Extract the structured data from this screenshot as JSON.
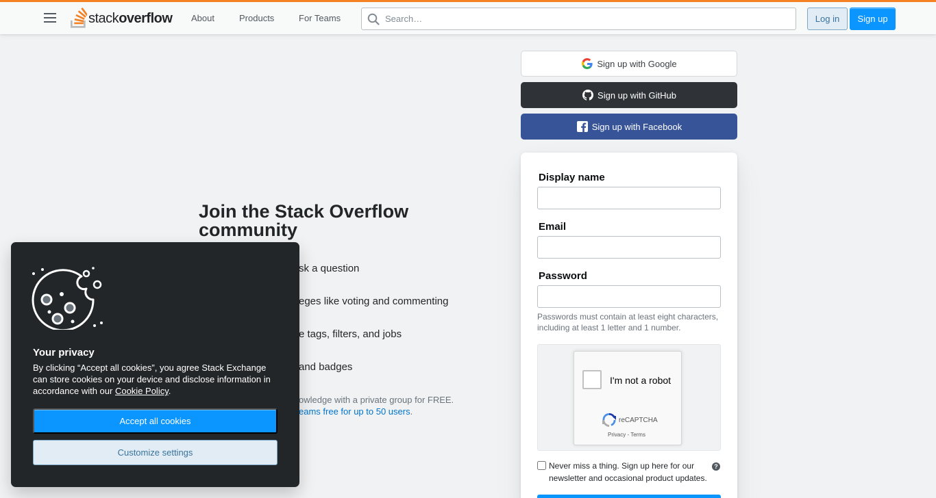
{
  "header": {
    "logo_text_light": "stack",
    "logo_text_bold": "overflow",
    "nav": [
      "About",
      "Products",
      "For Teams"
    ],
    "search_placeholder": "Search…",
    "login_label": "Log in",
    "signup_label": "Sign up"
  },
  "pitch": {
    "title": "Join the Stack Overflow community",
    "items": [
      "sk a question",
      "eges like voting and commenting",
      "e tags, filters, and jobs",
      "and badges"
    ],
    "note_line1": "owledge with a private group for FREE.",
    "note_link": "eams free for up to 50 users",
    "note_link_suffix": "."
  },
  "social": {
    "google": "Sign up with Google",
    "github": "Sign up with GitHub",
    "facebook": "Sign up with Facebook"
  },
  "form": {
    "display_name_label": "Display name",
    "email_label": "Email",
    "password_label": "Password",
    "password_hint": "Passwords must contain at least eight characters, including at least 1 letter and 1 number.",
    "captcha_label": "I'm not a robot",
    "captcha_brand": "reCAPTCHA",
    "captcha_links": "Privacy - Terms",
    "newsletter_text": "Never miss a thing. Sign up here for our newsletter and occasional product updates.",
    "help_glyph": "?"
  },
  "cookie": {
    "title": "Your privacy",
    "text_before": "By clicking “Accept all cookies”, you agree Stack Exchange can store cookies on your device and disclose information in accordance with our ",
    "link": "Cookie Policy",
    "text_after": ".",
    "accept_label": "Accept all cookies",
    "customize_label": "Customize settings"
  },
  "colors": {
    "accent_orange": "#f48225",
    "primary_blue": "#0a95ff",
    "github_dark": "#2f3337",
    "facebook_blue": "#385499",
    "cookie_bg": "#232629"
  }
}
